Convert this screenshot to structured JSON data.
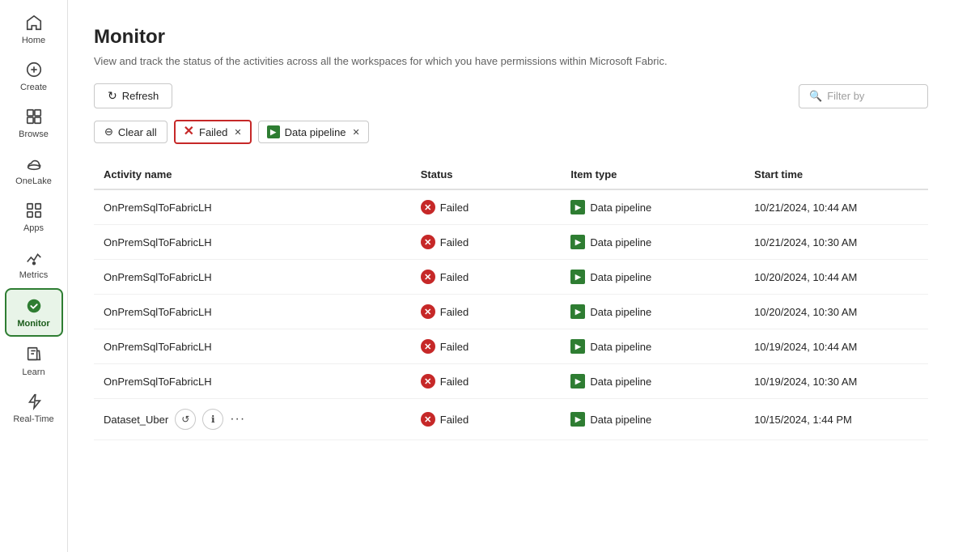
{
  "sidebar": {
    "items": [
      {
        "id": "home",
        "label": "Home",
        "icon": "home"
      },
      {
        "id": "create",
        "label": "Create",
        "icon": "create"
      },
      {
        "id": "browse",
        "label": "Browse",
        "icon": "browse"
      },
      {
        "id": "onelake",
        "label": "OneLake",
        "icon": "onelake"
      },
      {
        "id": "apps",
        "label": "Apps",
        "icon": "apps"
      },
      {
        "id": "metrics",
        "label": "Metrics",
        "icon": "metrics"
      },
      {
        "id": "monitor",
        "label": "Monitor",
        "icon": "monitor",
        "active": true
      },
      {
        "id": "learn",
        "label": "Learn",
        "icon": "learn"
      },
      {
        "id": "realtime",
        "label": "Real-Time",
        "icon": "realtime"
      }
    ]
  },
  "page": {
    "title": "Monitor",
    "description": "View and track the status of the activities across all the workspaces for which you have permissions within Microsoft Fabric."
  },
  "toolbar": {
    "refresh_label": "Refresh",
    "filter_placeholder": "Filter by"
  },
  "filters": {
    "clear_all_label": "Clear all",
    "tags": [
      {
        "id": "failed",
        "label": "Failed",
        "highlighted": true
      },
      {
        "id": "data-pipeline",
        "label": "Data pipeline",
        "highlighted": false
      }
    ]
  },
  "table": {
    "columns": [
      {
        "id": "activity-name",
        "label": "Activity name"
      },
      {
        "id": "status",
        "label": "Status"
      },
      {
        "id": "item-type",
        "label": "Item type"
      },
      {
        "id": "start-time",
        "label": "Start time"
      }
    ],
    "rows": [
      {
        "activity_name": "OnPremSqlToFabricLH",
        "status": "Failed",
        "item_type": "Data pipeline",
        "start_time": "10/21/2024, 10:44 AM",
        "show_actions": false
      },
      {
        "activity_name": "OnPremSqlToFabricLH",
        "status": "Failed",
        "item_type": "Data pipeline",
        "start_time": "10/21/2024, 10:30 AM",
        "show_actions": false
      },
      {
        "activity_name": "OnPremSqlToFabricLH",
        "status": "Failed",
        "item_type": "Data pipeline",
        "start_time": "10/20/2024, 10:44 AM",
        "show_actions": false
      },
      {
        "activity_name": "OnPremSqlToFabricLH",
        "status": "Failed",
        "item_type": "Data pipeline",
        "start_time": "10/20/2024, 10:30 AM",
        "show_actions": false
      },
      {
        "activity_name": "OnPremSqlToFabricLH",
        "status": "Failed",
        "item_type": "Data pipeline",
        "start_time": "10/19/2024, 10:44 AM",
        "show_actions": false
      },
      {
        "activity_name": "OnPremSqlToFabricLH",
        "status": "Failed",
        "item_type": "Data pipeline",
        "start_time": "10/19/2024, 10:30 AM",
        "show_actions": false
      },
      {
        "activity_name": "Dataset_Uber",
        "status": "Failed",
        "item_type": "Data pipeline",
        "start_time": "10/15/2024, 1:44 PM",
        "show_actions": true
      }
    ]
  },
  "colors": {
    "failed_red": "#c62828",
    "pipeline_green": "#2e7d32",
    "active_border": "#2e7d32",
    "failed_tag_border": "#c62828"
  }
}
